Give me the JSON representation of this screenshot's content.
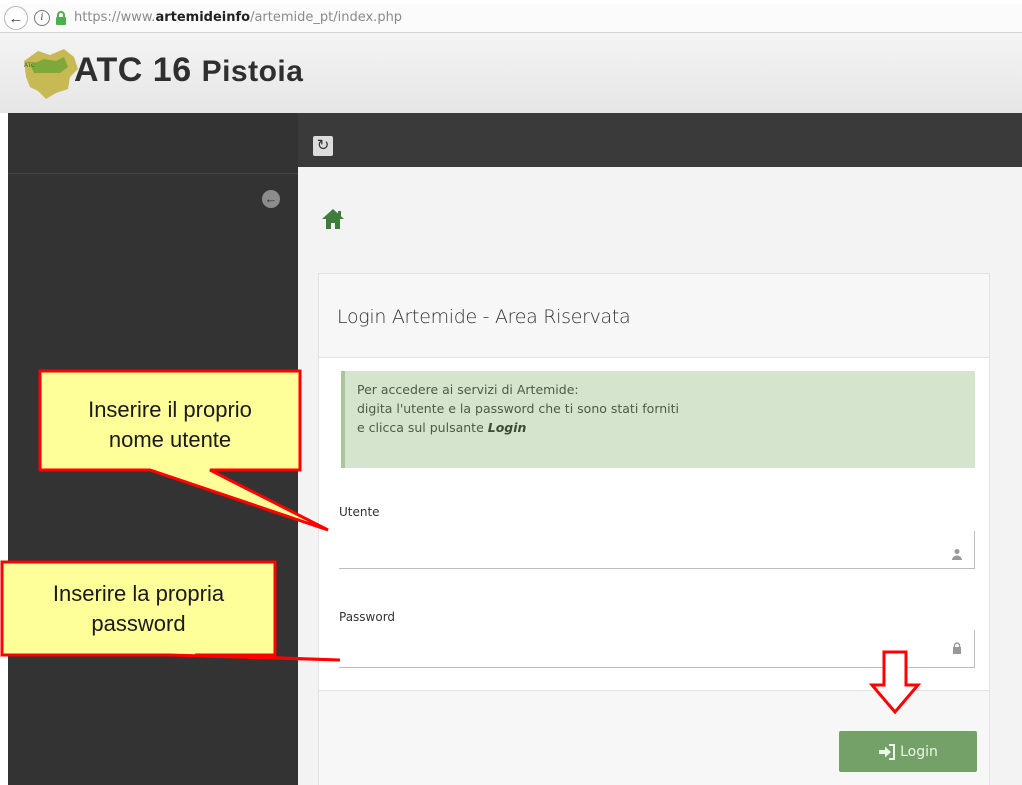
{
  "browser": {
    "url_prefix": "https://www.",
    "url_domain": "artemideinfo",
    "url_path": "/artemide_pt/index.php"
  },
  "app": {
    "title": "ATC 16",
    "title_suffix": "Pistoia"
  },
  "login_panel": {
    "title": "Login Artemide - Area Riservata",
    "alert_line1": "Per accedere ai servizi di Artemide:",
    "alert_line2": "digita l'utente e la password che ti sono stati forniti",
    "alert_line3_prefix": "e clicca sul pulsante ",
    "alert_line3_emphasis": "Login",
    "username_label": "Utente",
    "username_value": "",
    "password_label": "Password",
    "password_value": "",
    "login_button_label": "Login"
  },
  "annotations": {
    "username_callout": [
      "Inserire il proprio",
      "nome utente"
    ],
    "password_callout": [
      "Inserire la propria",
      "password"
    ]
  },
  "icons": {
    "back": "back-arrow-icon",
    "info": "info-icon",
    "lock": "lock-icon",
    "refresh": "refresh-icon",
    "collapse": "arrow-left-circle-icon",
    "home": "home-icon",
    "user": "user-icon",
    "password": "lock-icon",
    "login": "sign-in-icon"
  },
  "colors": {
    "sidebar": "#333333",
    "topbar": "#3a3a3a",
    "alert_bg": "#d5e5cd",
    "login_button": "#74a168",
    "callout_fill": "#ffff99",
    "callout_border": "#ff0000"
  }
}
